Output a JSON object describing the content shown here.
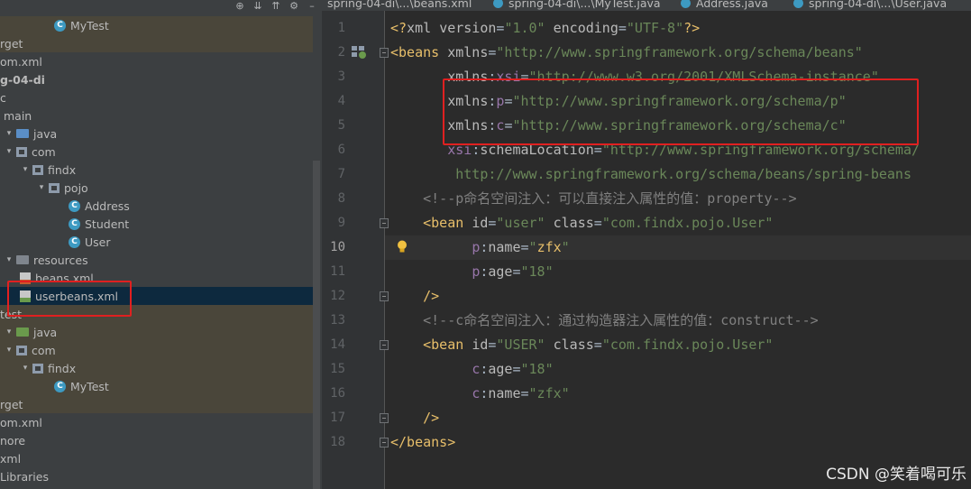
{
  "project": {
    "rows": [
      {
        "label": "MyTest",
        "icon": "class-icon",
        "tan": true
      },
      {
        "label": "rget",
        "icon": "",
        "tan": true
      },
      {
        "label": "om.xml",
        "icon": "",
        "tan": false
      },
      {
        "label": "g-04-di",
        "icon": "",
        "tan": false,
        "bold": true
      },
      {
        "label": "c",
        "icon": "",
        "tan": false
      },
      {
        "label": "main",
        "icon": "",
        "tan": false
      },
      {
        "label": "java",
        "icon": "folder-icon",
        "tan": false
      },
      {
        "label": "com",
        "icon": "package-icon",
        "tan": false
      },
      {
        "label": "findx",
        "icon": "package-icon",
        "tan": false
      },
      {
        "label": "pojo",
        "icon": "package-icon",
        "tan": false
      },
      {
        "label": "Address",
        "icon": "class-icon",
        "tan": false
      },
      {
        "label": "Student",
        "icon": "class-icon",
        "tan": false
      },
      {
        "label": "User",
        "icon": "class-icon",
        "tan": false
      },
      {
        "label": "resources",
        "icon": "folder-icon",
        "tan": false
      },
      {
        "label": "beans.xml",
        "icon": "xml-file-icon",
        "tan": false
      },
      {
        "label": "userbeans.xml",
        "icon": "xml-file-icon",
        "tan": false,
        "selected": true
      },
      {
        "label": "test",
        "icon": "",
        "tan": true
      },
      {
        "label": "java",
        "icon": "folder-icon",
        "tan": true
      },
      {
        "label": "com",
        "icon": "package-icon",
        "tan": true
      },
      {
        "label": "findx",
        "icon": "package-icon",
        "tan": true
      },
      {
        "label": "MyTest",
        "icon": "class-icon",
        "tan": true
      },
      {
        "label": "rget",
        "icon": "",
        "tan": true
      },
      {
        "label": "om.xml",
        "icon": "",
        "tan": false
      },
      {
        "label": "nore",
        "icon": "",
        "tan": false
      },
      {
        "label": "xml",
        "icon": "",
        "tan": false
      },
      {
        "label": "Libraries",
        "icon": "",
        "tan": false
      }
    ]
  },
  "tabs": [
    {
      "label": "spring-04-di\\...\\beans.xml",
      "icon": "xml-file-icon"
    },
    {
      "label": "spring-04-di\\...\\MyTest.java",
      "icon": "class-icon"
    },
    {
      "label": "Address.java",
      "icon": "class-icon"
    },
    {
      "label": "spring-04-di\\...\\User.java",
      "icon": "class-icon"
    }
  ],
  "editor": {
    "current_line": 10,
    "lines": [
      {
        "n": "1",
        "tokens": [
          [
            "t-punc",
            "<?"
          ],
          [
            "t-attr",
            "xml "
          ],
          [
            "t-attr",
            "version"
          ],
          [
            "t-txt",
            "="
          ],
          [
            "t-val",
            "\"1.0\""
          ],
          [
            "t-txt",
            " "
          ],
          [
            "t-attr",
            "encoding"
          ],
          [
            "t-txt",
            "="
          ],
          [
            "t-val",
            "\"UTF-8\""
          ],
          [
            "t-punc",
            "?>"
          ]
        ]
      },
      {
        "n": "2",
        "tokens": [
          [
            "t-punc",
            "<beans "
          ],
          [
            "t-attr",
            "xmlns"
          ],
          [
            "t-txt",
            "="
          ],
          [
            "t-val",
            "\"http://www.springframework.org/schema/beans\""
          ]
        ]
      },
      {
        "n": "3",
        "tokens": [
          [
            "t-txt",
            "       "
          ],
          [
            "t-attr",
            "xmlns"
          ],
          [
            "t-txt",
            ":"
          ],
          [
            "t-ns",
            "xsi"
          ],
          [
            "t-txt",
            "="
          ],
          [
            "t-val",
            "\"http://www.w3.org/2001/XMLSchema-instance\""
          ]
        ]
      },
      {
        "n": "4",
        "tokens": [
          [
            "t-txt",
            "       "
          ],
          [
            "t-attr",
            "xmlns"
          ],
          [
            "t-txt",
            ":"
          ],
          [
            "t-ns",
            "p"
          ],
          [
            "t-txt",
            "="
          ],
          [
            "t-val",
            "\"http://www.springframework.org/schema/p\""
          ]
        ]
      },
      {
        "n": "5",
        "tokens": [
          [
            "t-txt",
            "       "
          ],
          [
            "t-attr",
            "xmlns"
          ],
          [
            "t-txt",
            ":"
          ],
          [
            "t-ns",
            "c"
          ],
          [
            "t-txt",
            "="
          ],
          [
            "t-val",
            "\"http://www.springframework.org/schema/c\""
          ]
        ]
      },
      {
        "n": "6",
        "tokens": [
          [
            "t-txt",
            "       "
          ],
          [
            "t-ns",
            "xsi"
          ],
          [
            "t-txt",
            ":"
          ],
          [
            "t-attr",
            "schemaLocation"
          ],
          [
            "t-txt",
            "="
          ],
          [
            "t-val",
            "\"http://www.springframework.org/schema/"
          ]
        ]
      },
      {
        "n": "7",
        "tokens": [
          [
            "t-val",
            "        http://www.springframework.org/schema/beans/spring-beans"
          ]
        ]
      },
      {
        "n": "8",
        "tokens": [
          [
            "t-txt",
            "    "
          ],
          [
            "t-com",
            "<!--p命名空间注入：可以直接注入属性的值：property-->"
          ]
        ]
      },
      {
        "n": "9",
        "tokens": [
          [
            "t-txt",
            "    "
          ],
          [
            "t-punc",
            "<bean "
          ],
          [
            "t-attr",
            "id"
          ],
          [
            "t-txt",
            "="
          ],
          [
            "t-val",
            "\"user\""
          ],
          [
            "t-txt",
            " "
          ],
          [
            "t-attr",
            "class"
          ],
          [
            "t-txt",
            "="
          ],
          [
            "t-val",
            "\"com.findx.pojo.User\""
          ]
        ]
      },
      {
        "n": "10",
        "tokens": [
          [
            "t-txt",
            "          "
          ],
          [
            "t-ns",
            "p"
          ],
          [
            "t-txt",
            ":"
          ],
          [
            "t-attr",
            "name"
          ],
          [
            "t-txt",
            "="
          ],
          [
            "t-val",
            "\""
          ],
          [
            "t-punc",
            "zfx"
          ],
          [
            "t-val",
            "\""
          ]
        ]
      },
      {
        "n": "11",
        "tokens": [
          [
            "t-txt",
            "          "
          ],
          [
            "t-ns",
            "p"
          ],
          [
            "t-txt",
            ":"
          ],
          [
            "t-attr",
            "age"
          ],
          [
            "t-txt",
            "="
          ],
          [
            "t-val",
            "\"18\""
          ]
        ]
      },
      {
        "n": "12",
        "tokens": [
          [
            "t-txt",
            "    "
          ],
          [
            "t-punc",
            "/>"
          ]
        ]
      },
      {
        "n": "13",
        "tokens": [
          [
            "t-txt",
            "    "
          ],
          [
            "t-com",
            "<!--c命名空间注入：通过构造器注入属性的值：construct-->"
          ]
        ]
      },
      {
        "n": "14",
        "tokens": [
          [
            "t-txt",
            "    "
          ],
          [
            "t-punc",
            "<bean "
          ],
          [
            "t-attr",
            "id"
          ],
          [
            "t-txt",
            "="
          ],
          [
            "t-val",
            "\"USER\""
          ],
          [
            "t-txt",
            " "
          ],
          [
            "t-attr",
            "class"
          ],
          [
            "t-txt",
            "="
          ],
          [
            "t-val",
            "\"com.findx.pojo.User\""
          ]
        ]
      },
      {
        "n": "15",
        "tokens": [
          [
            "t-txt",
            "          "
          ],
          [
            "t-ns",
            "c"
          ],
          [
            "t-txt",
            ":"
          ],
          [
            "t-attr",
            "age"
          ],
          [
            "t-txt",
            "="
          ],
          [
            "t-val",
            "\"18\""
          ]
        ]
      },
      {
        "n": "16",
        "tokens": [
          [
            "t-txt",
            "          "
          ],
          [
            "t-ns",
            "c"
          ],
          [
            "t-txt",
            ":"
          ],
          [
            "t-attr",
            "name"
          ],
          [
            "t-txt",
            "="
          ],
          [
            "t-val",
            "\"zfx\""
          ]
        ]
      },
      {
        "n": "17",
        "tokens": [
          [
            "t-txt",
            "    "
          ],
          [
            "t-punc",
            "/>"
          ]
        ]
      },
      {
        "n": "18",
        "tokens": [
          [
            "t-punc",
            "</beans>"
          ]
        ]
      }
    ]
  },
  "watermark": "CSDN @笑着喝可乐"
}
